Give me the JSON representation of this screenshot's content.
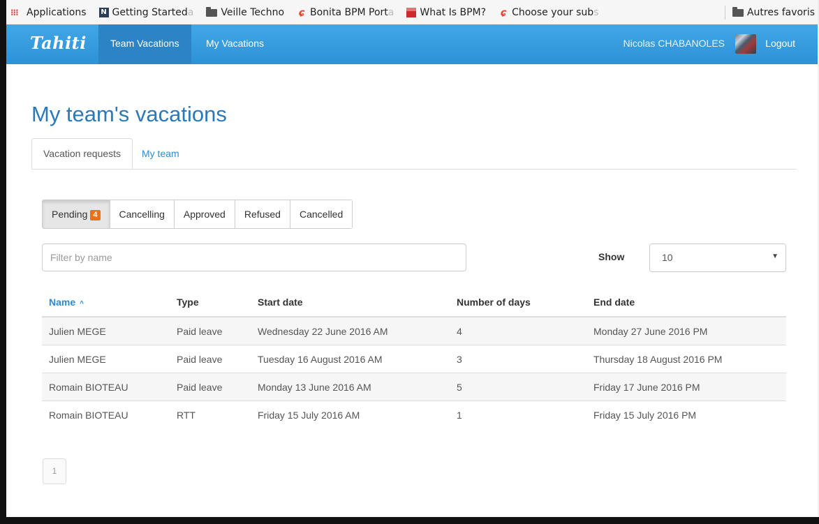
{
  "bookmarks": {
    "items": [
      {
        "label": "Applications",
        "icon": "apps-grid-icon"
      },
      {
        "label": "Getting Started",
        "fade": "a",
        "icon": "getting-started-icon"
      },
      {
        "label": "Veille Techno",
        "icon": "folder-icon"
      },
      {
        "label": "Bonita BPM Port",
        "fade": "a",
        "icon": "bonita-icon"
      },
      {
        "label": "What Is BPM?",
        "icon": "bpm-icon"
      },
      {
        "label": "Choose your sub",
        "fade": "s",
        "icon": "bonita-icon"
      }
    ],
    "other": "Autres favoris"
  },
  "navbar": {
    "brand": "Tahiti",
    "team_vacations": "Team Vacations",
    "my_vacations": "My Vacations",
    "user_name": "Nicolas CHABANOLES",
    "logout": "Logout"
  },
  "page": {
    "title": "My team's vacations",
    "tabs": [
      "Vacation requests",
      "My team"
    ]
  },
  "filters": {
    "pending": "Pending",
    "pending_count": "4",
    "cancelling": "Cancelling",
    "approved": "Approved",
    "refused": "Refused",
    "cancelled": "Cancelled"
  },
  "search": {
    "placeholder": "Filter by name"
  },
  "show": {
    "label": "Show",
    "value": "10"
  },
  "table": {
    "headers": [
      "Name",
      "Type",
      "Start date",
      "Number of days",
      "End date"
    ],
    "rows": [
      [
        "Julien MEGE",
        "Paid leave",
        "Wednesday 22 June 2016 AM",
        "4",
        "Monday 27 June 2016 PM"
      ],
      [
        "Julien MEGE",
        "Paid leave",
        "Tuesday 16 August 2016 AM",
        "3",
        "Thursday 18 August 2016 PM"
      ],
      [
        "Romain BIOTEAU",
        "Paid leave",
        "Monday 13 June 2016 AM",
        "5",
        "Friday 17 June 2016 PM"
      ],
      [
        "Romain BIOTEAU",
        "RTT",
        "Friday 15 July 2016 AM",
        "1",
        "Friday 15 July 2016 PM"
      ]
    ]
  },
  "pagination": {
    "current": "1"
  },
  "colors": {
    "navbar": "#3a9fe0",
    "accent": "#2a8ad3",
    "badge": "#e8711a",
    "title": "#2b79b8"
  }
}
